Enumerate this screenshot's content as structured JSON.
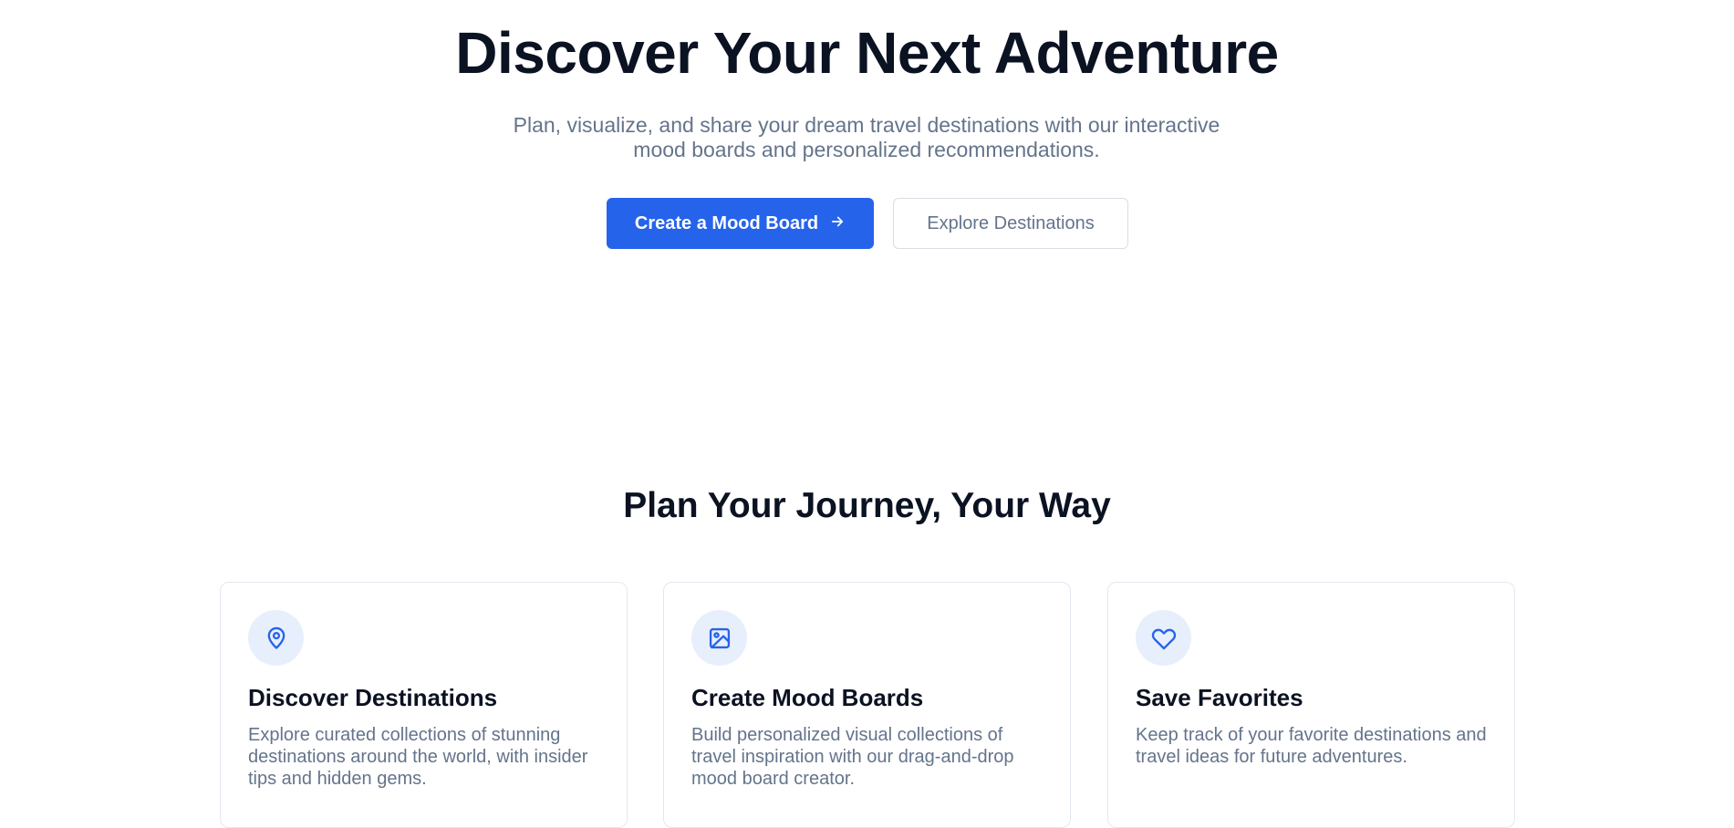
{
  "hero": {
    "title": "Discover Your Next Adventure",
    "subtitle": "Plan, visualize, and share your dream travel destinations with our interactive mood boards and personalized recommendations.",
    "primary_button": "Create a Mood Board",
    "primary_button_icon": "arrow-right-icon",
    "secondary_button": "Explore Destinations"
  },
  "features": {
    "title": "Plan Your Journey, Your Way",
    "cards": [
      {
        "icon": "map-pin-icon",
        "title": "Discover Destinations",
        "description": "Explore curated collections of stunning destinations around the world, with insider tips and hidden gems."
      },
      {
        "icon": "image-icon",
        "title": "Create Mood Boards",
        "description": "Build personalized visual collections of travel inspiration with our drag-and-drop mood board creator."
      },
      {
        "icon": "heart-icon",
        "title": "Save Favorites",
        "description": "Keep track of your favorite destinations and travel ideas for future adventures."
      }
    ]
  },
  "colors": {
    "primary": "#2563eb",
    "heading": "#0b1222",
    "muted_text": "#64748b",
    "icon_bg": "#e8effc",
    "border": "#e2e8f0"
  }
}
